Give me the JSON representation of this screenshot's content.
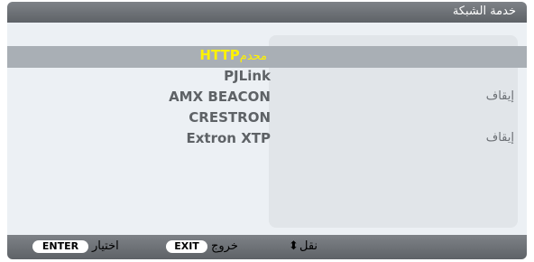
{
  "title": "خدمة الشبكة",
  "menu": {
    "items": [
      {
        "label": "HTTP",
        "suffix": "محدم",
        "value": ""
      },
      {
        "label": "PJLink",
        "suffix": "",
        "value": ""
      },
      {
        "label": "AMX BEACON",
        "suffix": "",
        "value": "إيقاف"
      },
      {
        "label": "CRESTRON",
        "suffix": "",
        "value": ""
      },
      {
        "label": "Extron XTP",
        "suffix": "",
        "value": "إيقاف"
      }
    ],
    "selected_index": 0
  },
  "footer": {
    "enter_key": "ENTER",
    "enter_label": "اختيار",
    "exit_key": "EXIT",
    "exit_label": "خروج",
    "move_label": "نقل",
    "move_icon": "up-down-arrow-icon"
  },
  "colors": {
    "highlight_text": "#fff200",
    "selected_row": "#a9afb5"
  }
}
